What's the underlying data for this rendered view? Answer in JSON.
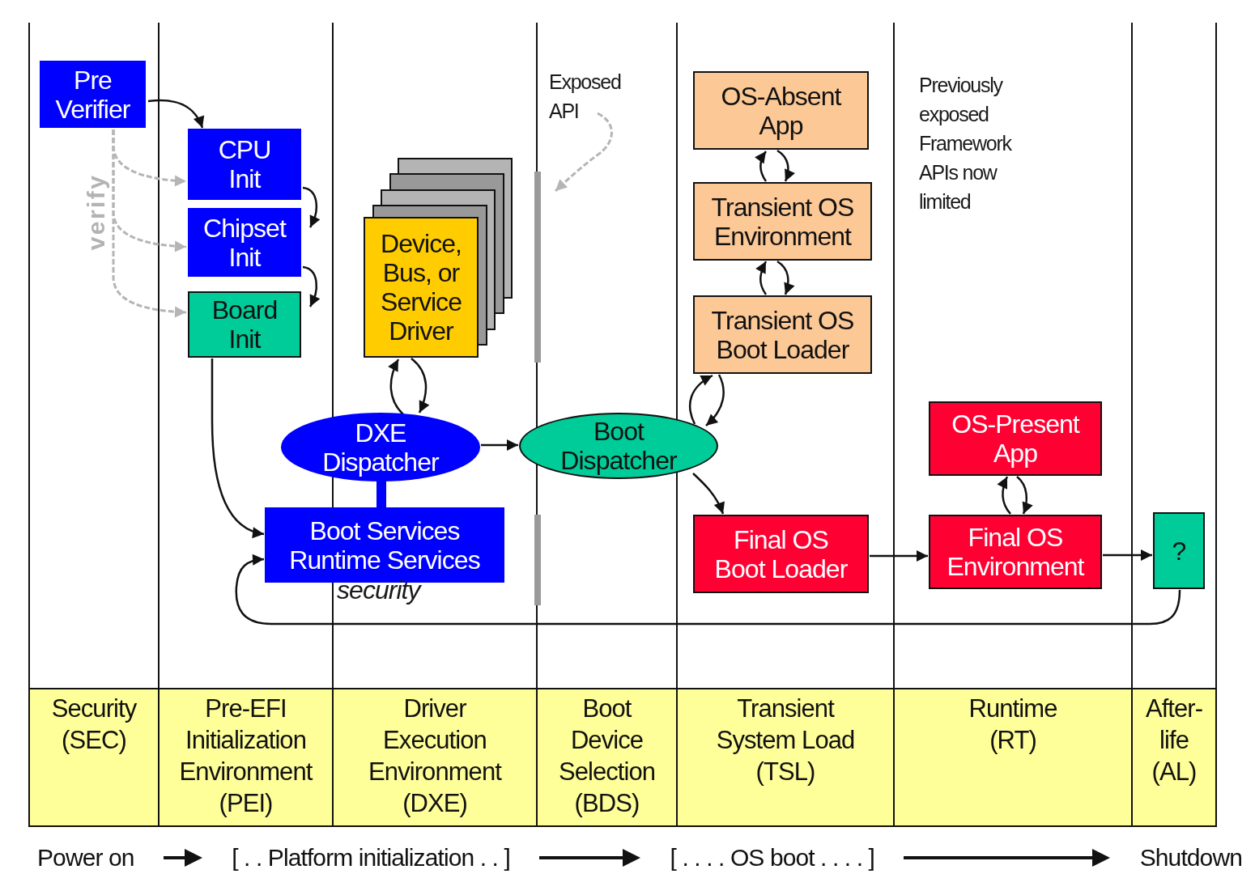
{
  "nodes": [
    {
      "kind": "box",
      "lines": [
        "Pre",
        "Verifier"
      ],
      "color": "#0000ff"
    },
    {
      "kind": "box",
      "lines": [
        "CPU",
        "Init"
      ],
      "color": "#0000ff"
    },
    {
      "kind": "box",
      "lines": [
        "Chipset",
        "Init"
      ],
      "color": "#0000ff"
    },
    {
      "kind": "box",
      "lines": [
        "Board",
        "Init"
      ],
      "color": "#00cc99"
    },
    {
      "kind": "stack",
      "lines": [
        "Device,",
        "Bus, or",
        "Service",
        "Driver"
      ],
      "color": "#ffcc00"
    },
    {
      "kind": "ellipse",
      "lines": [
        "DXE",
        "Dispatcher"
      ],
      "color": "#0000ff"
    },
    {
      "kind": "box",
      "lines": [
        "Boot Services",
        "Runtime Services"
      ],
      "color": "#0000ff"
    },
    {
      "kind": "ellipse",
      "lines": [
        "Boot",
        "Dispatcher"
      ],
      "color": "#00cc99"
    },
    {
      "kind": "box",
      "lines": [
        "OS-Absent",
        "App"
      ],
      "color": "#fcc896"
    },
    {
      "kind": "box",
      "lines": [
        "Transient OS",
        "Environment"
      ],
      "color": "#fcc896"
    },
    {
      "kind": "box",
      "lines": [
        "Transient OS",
        "Boot Loader"
      ],
      "color": "#fcc896"
    },
    {
      "kind": "box",
      "lines": [
        "OS-Present",
        "App"
      ],
      "color": "#ff0033"
    },
    {
      "kind": "box",
      "lines": [
        "Final OS",
        "Boot Loader"
      ],
      "color": "#ff0033"
    },
    {
      "kind": "box",
      "lines": [
        "Final OS",
        "Environment"
      ],
      "color": "#ff0033"
    },
    {
      "kind": "box",
      "lines": [
        "?"
      ],
      "color": "#00cc99"
    }
  ],
  "notes": [
    {
      "kind": "rotated",
      "lines": [
        "verify"
      ]
    },
    {
      "kind": "italic",
      "lines": [
        "security"
      ]
    },
    {
      "kind": "plain",
      "lines": [
        "Exposed",
        "API"
      ]
    },
    {
      "kind": "plain",
      "lines": [
        "Previously",
        "exposed",
        "Framework",
        "APIs now",
        "limited"
      ]
    }
  ],
  "lanes": [
    {
      "lines": [
        "Security",
        "(SEC)"
      ]
    },
    {
      "lines": [
        "Pre-EFI",
        "Initialization",
        "Environment",
        "(PEI)"
      ]
    },
    {
      "lines": [
        "Driver",
        "Execution",
        "Environment",
        "(DXE)"
      ]
    },
    {
      "lines": [
        "Boot",
        "Device",
        "Selection",
        "(BDS)"
      ]
    },
    {
      "lines": [
        "Transient",
        "System Load",
        "(TSL)"
      ]
    },
    {
      "lines": [
        "Runtime",
        "(RT)"
      ]
    },
    {
      "lines": [
        "After-",
        "life",
        "(AL)"
      ]
    }
  ],
  "timeline": [
    "Power on",
    "[ . . Platform initialization . . ]",
    "[ . . . . OS boot . . . . ]",
    "Shutdown"
  ]
}
